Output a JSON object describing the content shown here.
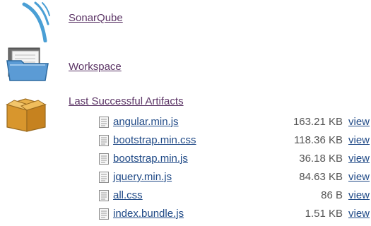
{
  "sections": {
    "sonarqube": {
      "label": "SonarQube",
      "icon": "sonarqube-icon"
    },
    "workspace": {
      "label": "Workspace",
      "icon": "folder-icon"
    },
    "artifacts": {
      "label": "Last Successful Artifacts",
      "icon": "package-box-icon"
    }
  },
  "artifacts": [
    {
      "name": "angular.min.js",
      "size": "163.21 KB",
      "view": "view"
    },
    {
      "name": "bootstrap.min.css",
      "size": "118.36 KB",
      "view": "view"
    },
    {
      "name": "bootstrap.min.js",
      "size": "36.18 KB",
      "view": "view"
    },
    {
      "name": "jquery.min.js",
      "size": "84.63 KB",
      "view": "view"
    },
    {
      "name": "all.css",
      "size": "86 B",
      "view": "view"
    },
    {
      "name": "index.bundle.js",
      "size": "1.51 KB",
      "view": "view"
    }
  ],
  "colors": {
    "link": "#5c3566",
    "view_link": "#204a87"
  }
}
